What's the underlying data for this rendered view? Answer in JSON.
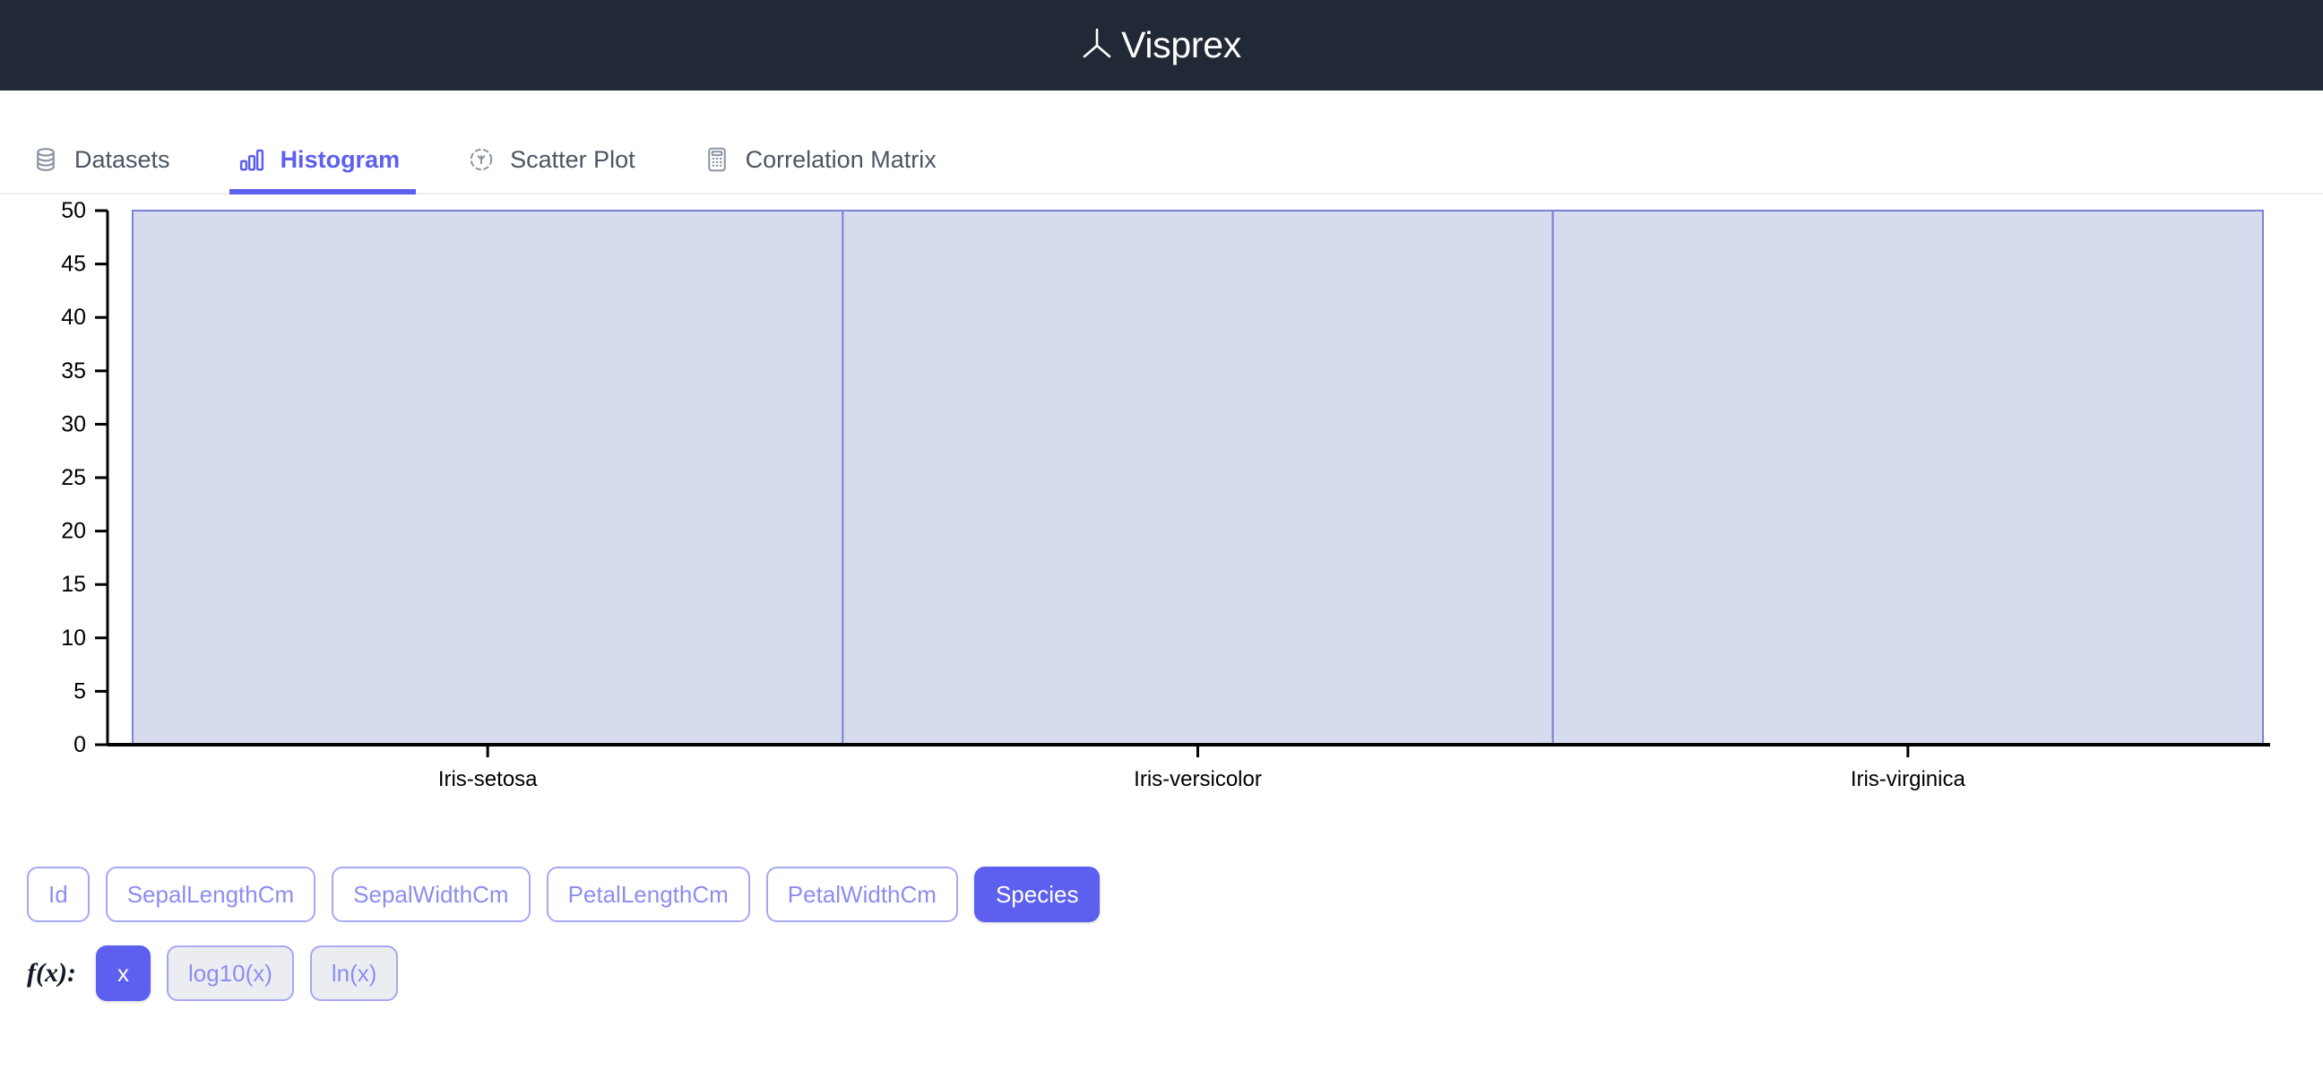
{
  "header": {
    "brand_name": "Visprex",
    "logo_icon": "visprex-trident-logo",
    "bg_color": "#212936"
  },
  "tabs": [
    {
      "id": "datasets",
      "label": "Datasets",
      "icon": "database-icon",
      "active": false
    },
    {
      "id": "histogram",
      "label": "Histogram",
      "icon": "bar-chart-icon",
      "active": true
    },
    {
      "id": "scatter-plot",
      "label": "Scatter Plot",
      "icon": "scatter-plot-icon",
      "active": false
    },
    {
      "id": "correlation-matrix",
      "label": "Correlation Matrix",
      "icon": "calculator-icon",
      "active": false
    }
  ],
  "chart_data": {
    "type": "bar",
    "title": "",
    "xlabel": "",
    "ylabel": "",
    "categories": [
      "Iris-setosa",
      "Iris-versicolor",
      "Iris-virginica"
    ],
    "values": [
      50,
      50,
      50
    ],
    "yticks": [
      0,
      5,
      10,
      15,
      20,
      25,
      30,
      35,
      40,
      45,
      50
    ],
    "ylim": [
      0,
      50
    ],
    "grid": false,
    "legend": "none",
    "bar_fill": "#d6dbee",
    "bar_stroke": "#7b82d4",
    "axis_color": "#000000"
  },
  "columns": {
    "items": [
      {
        "label": "Id",
        "active": false
      },
      {
        "label": "SepalLengthCm",
        "active": false
      },
      {
        "label": "SepalWidthCm",
        "active": false
      },
      {
        "label": "PetalLengthCm",
        "active": false
      },
      {
        "label": "PetalWidthCm",
        "active": false
      },
      {
        "label": "Species",
        "active": true
      }
    ]
  },
  "transform": {
    "label": "f(x):",
    "options": [
      {
        "label": "x",
        "active": true
      },
      {
        "label": "log10(x)",
        "active": false
      },
      {
        "label": "ln(x)",
        "active": false
      }
    ]
  },
  "theme": {
    "accent": "#5d5fef",
    "accent_soft": "#a5a8f3",
    "text_muted": "#4b5563"
  }
}
